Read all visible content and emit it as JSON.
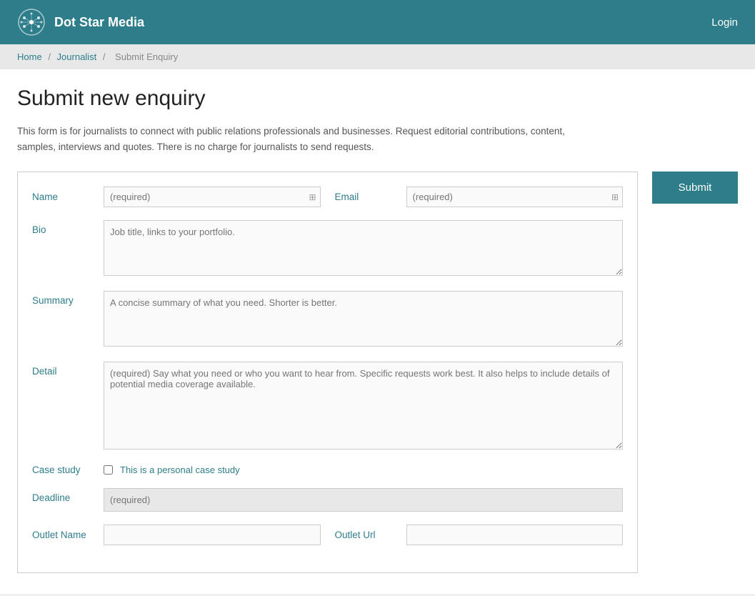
{
  "header": {
    "brand_name": "Dot Star Media",
    "login_label": "Login"
  },
  "breadcrumb": {
    "home": "Home",
    "journalist": "Journalist",
    "current": "Submit Enquiry"
  },
  "page": {
    "title": "Submit new enquiry",
    "intro": "This form is for journalists to connect with public relations professionals and businesses. Request editorial contributions, content, samples, interviews and quotes. There is no charge for journalists to send requests."
  },
  "form": {
    "name_label": "Name",
    "name_placeholder": "(required)",
    "email_label": "Email",
    "email_placeholder": "(required)",
    "bio_label": "Bio",
    "bio_placeholder": "Job title, links to your portfolio.",
    "summary_label": "Summary",
    "summary_placeholder": "A concise summary of what you need. Shorter is better.",
    "detail_label": "Detail",
    "detail_placeholder": "(required) Say what you need or who you want to hear from. Specific requests work best. It also helps to include details of potential media coverage available.",
    "case_study_label": "Case study",
    "case_study_check_label": "This is a personal case study",
    "deadline_label": "Deadline",
    "deadline_placeholder": "(required)",
    "outlet_name_label": "Outlet Name",
    "outlet_url_label": "Outlet Url",
    "submit_label": "Submit"
  }
}
